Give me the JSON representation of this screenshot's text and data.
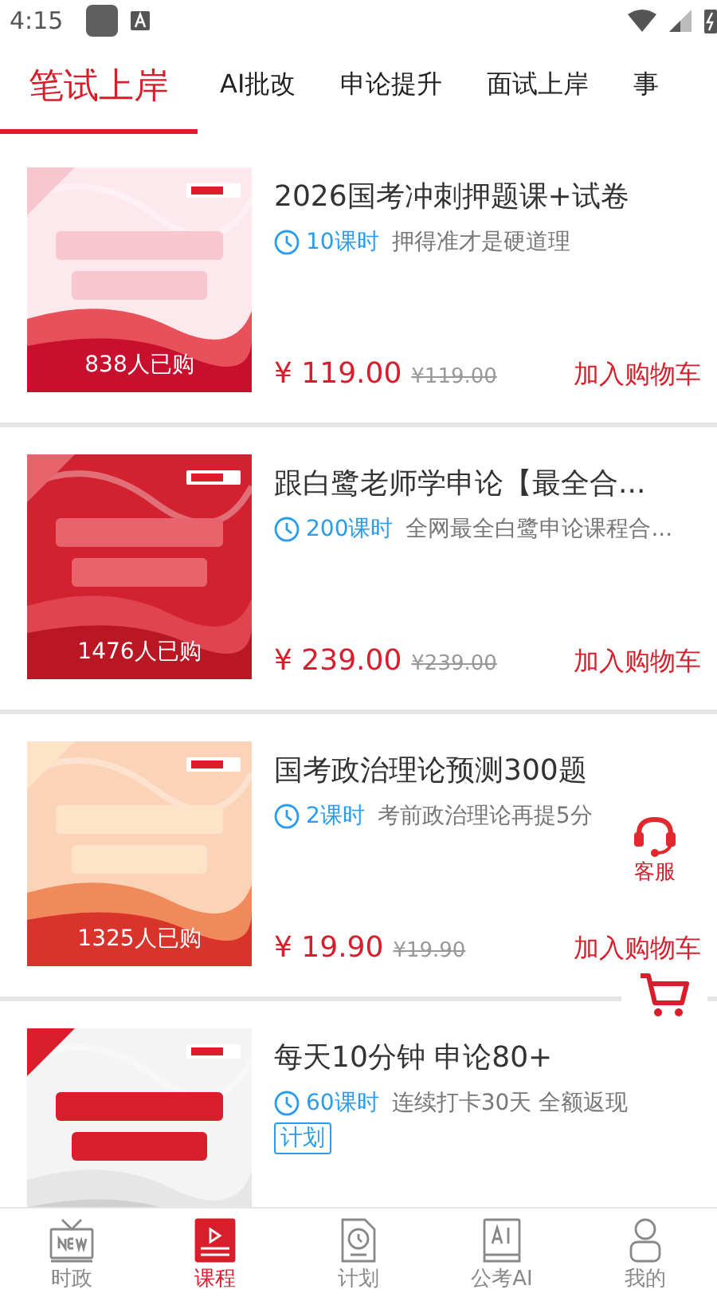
{
  "status_bar": {
    "time": "4:15"
  },
  "tabs": [
    {
      "label": "笔试上岸",
      "selected": true
    },
    {
      "label": "AI批改",
      "selected": false
    },
    {
      "label": "申论提升",
      "selected": false
    },
    {
      "label": "面试上岸",
      "selected": false
    },
    {
      "label": "事",
      "selected": false
    }
  ],
  "courses": [
    {
      "cover": {
        "purchases": "838人已购"
      },
      "title": "2026国考冲刺押题课+试卷",
      "hours": "10课时",
      "description": "押得准才是硬道理",
      "price": "¥ 119.00",
      "original_price": "¥119.00",
      "cart_button": "加入购物车"
    },
    {
      "cover": {
        "purchases": "1476人已购"
      },
      "title": "跟白鹭老师学申论【最全合...",
      "hours": "200课时",
      "description": "全网最全白鹭申论课程合...",
      "price": "¥ 239.00",
      "original_price": "¥239.00",
      "cart_button": "加入购物车"
    },
    {
      "cover": {
        "purchases": "1325人已购"
      },
      "title": "国考政治理论预测300题",
      "hours": "2课时",
      "description": "考前政治理论再提5分",
      "price": "¥ 19.90",
      "original_price": "¥19.90",
      "cart_button": "加入购物车"
    },
    {
      "title": "每天10分钟 申论80+",
      "hours": "60课时",
      "description": "连续打卡30天 全额返现",
      "tag": "计划"
    }
  ],
  "floating": {
    "service_label": "客服"
  },
  "bottom_nav": [
    {
      "label": "时政",
      "selected": false
    },
    {
      "label": "课程",
      "selected": true
    },
    {
      "label": "计划",
      "selected": false
    },
    {
      "label": "公考AI",
      "selected": false
    },
    {
      "label": "我的",
      "selected": false
    }
  ]
}
